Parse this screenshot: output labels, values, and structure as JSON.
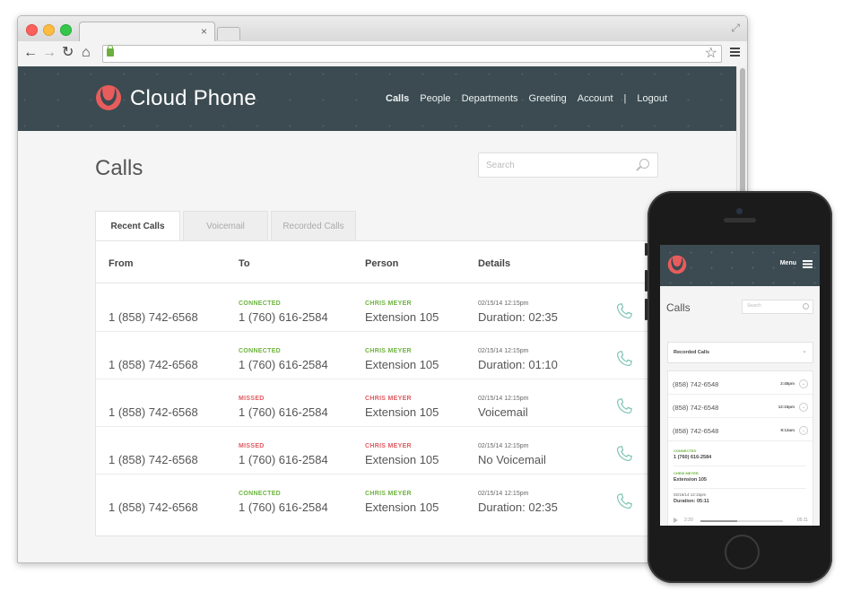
{
  "browser": {
    "tab_close": "×"
  },
  "site": {
    "brand": "Cloud Phone",
    "nav": [
      "Calls",
      "People",
      "Departments",
      "Greeting",
      "Account",
      "|",
      "Logout"
    ],
    "accent": "#e85c5c",
    "header_bg": "#3b4b51"
  },
  "page": {
    "title": "Calls",
    "search_placeholder": "Search",
    "tabs": [
      "Recent Calls",
      "Voicemail",
      "Recorded Calls"
    ],
    "columns": [
      "From",
      "To",
      "Person",
      "Details"
    ],
    "rows": [
      {
        "from": "1 (858) 742-6568",
        "status": "CONNECTED",
        "to": "1 (760) 616-2584",
        "person": "CHRIS MEYER",
        "ext": "Extension 105",
        "datetime": "02/15/14  12:15pm",
        "detail": "Duration: 02:35",
        "kind": "connected"
      },
      {
        "from": "1 (858) 742-6568",
        "status": "CONNECTED",
        "to": "1 (760) 616-2584",
        "person": "CHRIS MEYER",
        "ext": "Extension 105",
        "datetime": "02/15/14  12:15pm",
        "detail": "Duration: 01:10",
        "kind": "connected"
      },
      {
        "from": "1 (858) 742-6568",
        "status": "MISSED",
        "to": "1 (760) 616-2584",
        "person": "CHRIS MEYER",
        "ext": "Extension 105",
        "datetime": "02/15/14  12:15pm",
        "detail": "Voicemail",
        "kind": "missed"
      },
      {
        "from": "1 (858) 742-6568",
        "status": "MISSED",
        "to": "1 (760) 616-2584",
        "person": "CHRIS MEYER",
        "ext": "Extension 105",
        "datetime": "02/15/14  12:15pm",
        "detail": "No Voicemail",
        "kind": "missed"
      },
      {
        "from": "1 (858) 742-6568",
        "status": "CONNECTED",
        "to": "1 (760) 616-2584",
        "person": "CHRIS MEYER",
        "ext": "Extension 105",
        "datetime": "02/15/14  12:15pm",
        "detail": "Duration: 02:35",
        "kind": "connected"
      }
    ]
  },
  "mobile": {
    "menu_label": "Menu",
    "title": "Calls",
    "search_placeholder": "Search",
    "selected_tab": "Recorded Calls",
    "items": [
      {
        "number": "(858) 742-6548",
        "time": "2:45pm"
      },
      {
        "number": "(858) 742-6548",
        "time": "12:15pm"
      },
      {
        "number": "(858) 742-6548",
        "time": "9:13am"
      }
    ],
    "expanded": {
      "status": "CONNECTED",
      "to": "1 (760) 616-2584",
      "person": "CHRIS MEYER",
      "ext": "Extension 105",
      "datetime": "02/15/14  12:15pm",
      "duration": "Duration: 05:11",
      "elapsed": "2:20",
      "total": "05:11",
      "progress": 0.45
    }
  }
}
